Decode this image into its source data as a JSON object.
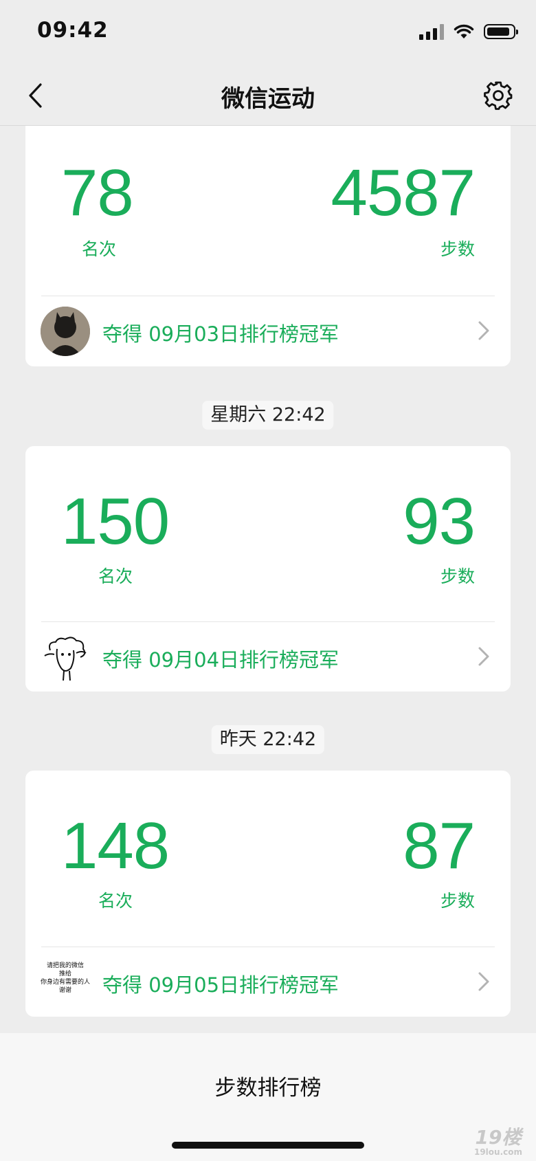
{
  "status_bar": {
    "time": "09:42"
  },
  "nav": {
    "title": "微信运动",
    "back_icon": "chevron-left-icon",
    "settings_icon": "gear-icon"
  },
  "colors": {
    "accent": "#1aad5a",
    "background": "#ededed",
    "card": "#ffffff"
  },
  "entries": [
    {
      "time_label": "",
      "rank": "78",
      "rank_label": "名次",
      "steps": "4587",
      "steps_label": "步数",
      "champion_text": "夺得 09月03日排行榜冠军"
    },
    {
      "time_label": "星期六 22:42",
      "rank": "150",
      "rank_label": "名次",
      "steps": "93",
      "steps_label": "步数",
      "champion_text": "夺得 09月04日排行榜冠军"
    },
    {
      "time_label": "昨天 22:42",
      "rank": "148",
      "rank_label": "名次",
      "steps": "87",
      "steps_label": "步数",
      "champion_text": "夺得 09月05日排行榜冠军"
    }
  ],
  "avatar3_text": [
    "请把我的微信",
    "推给",
    "你身边有需要的人",
    "谢谢"
  ],
  "bottom": {
    "leaderboard_label": "步数排行榜"
  },
  "watermark": {
    "big": "19楼",
    "small": "19lou.com"
  }
}
